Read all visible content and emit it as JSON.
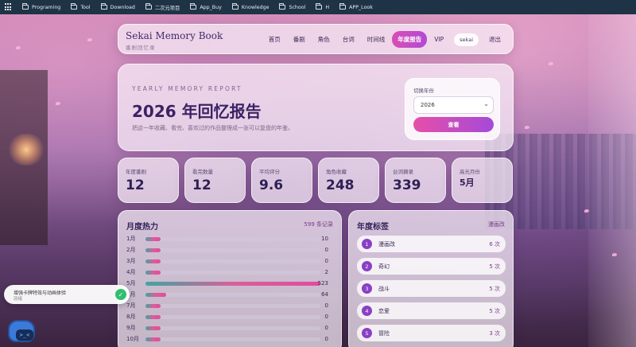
{
  "bookmarks": [
    {
      "label": "Programing"
    },
    {
      "label": "Tool"
    },
    {
      "label": "Download"
    },
    {
      "label": "二次元项目"
    },
    {
      "label": "App_Buy"
    },
    {
      "label": "Knowledge"
    },
    {
      "label": "School"
    },
    {
      "label": "H"
    },
    {
      "label": "APP_Look"
    }
  ],
  "header": {
    "brand_title": "Sekai Memory Book",
    "brand_subtitle": "番剧回忆录",
    "nav": [
      {
        "label": "首页"
      },
      {
        "label": "番剧"
      },
      {
        "label": "角色"
      },
      {
        "label": "台词"
      },
      {
        "label": "时间线"
      },
      {
        "label": "年度报告"
      },
      {
        "label": "VIP"
      },
      {
        "label": "sekai"
      },
      {
        "label": "退出"
      }
    ]
  },
  "hero": {
    "kicker": "YEARLY MEMORY REPORT",
    "title": "2026 年回忆报告",
    "description": "把这一年收藏、看完、喜欢过的作品整理成一张可以复盘的年鉴。",
    "year_label": "切换年份",
    "year_value": "2026",
    "view_button": "查看"
  },
  "stats": [
    {
      "label": "年度番剧",
      "value": "12"
    },
    {
      "label": "看完数量",
      "value": "12"
    },
    {
      "label": "平均评分",
      "value": "9.6"
    },
    {
      "label": "角色收藏",
      "value": "248"
    },
    {
      "label": "台词摘录",
      "value": "339"
    },
    {
      "label": "高光月份",
      "value": "5月"
    }
  ],
  "monthly": {
    "title": "月度热力",
    "meta": "599 条记录",
    "rows": [
      {
        "month": "1月",
        "count": "10",
        "fraction": 0.085
      },
      {
        "month": "2月",
        "count": "0",
        "fraction": 0.085
      },
      {
        "month": "3月",
        "count": "0",
        "fraction": 0.085
      },
      {
        "month": "4月",
        "count": "2",
        "fraction": 0.085
      },
      {
        "month": "5月",
        "count": "523",
        "fraction": 1.0
      },
      {
        "month": "6月",
        "count": "64",
        "fraction": 0.12
      },
      {
        "month": "7月",
        "count": "0",
        "fraction": 0.085
      },
      {
        "month": "8月",
        "count": "0",
        "fraction": 0.085
      },
      {
        "month": "9月",
        "count": "0",
        "fraction": 0.085
      },
      {
        "month": "10月",
        "count": "0",
        "fraction": 0.085
      }
    ]
  },
  "tags": {
    "title": "年度标签",
    "meta": "漫画改",
    "rows": [
      {
        "rank": "1",
        "name": "漫画改",
        "count": "6 次"
      },
      {
        "rank": "2",
        "name": "奇幻",
        "count": "5 次"
      },
      {
        "rank": "3",
        "name": "战斗",
        "count": "5 次"
      },
      {
        "rank": "4",
        "name": "恋爱",
        "count": "5 次"
      },
      {
        "rank": "5",
        "name": "冒险",
        "count": "3 次"
      }
    ]
  },
  "toast": {
    "title": "增强卡牌特效与动画体验",
    "subtitle": "就绪"
  },
  "mascot": {
    "face": ">_<"
  }
}
